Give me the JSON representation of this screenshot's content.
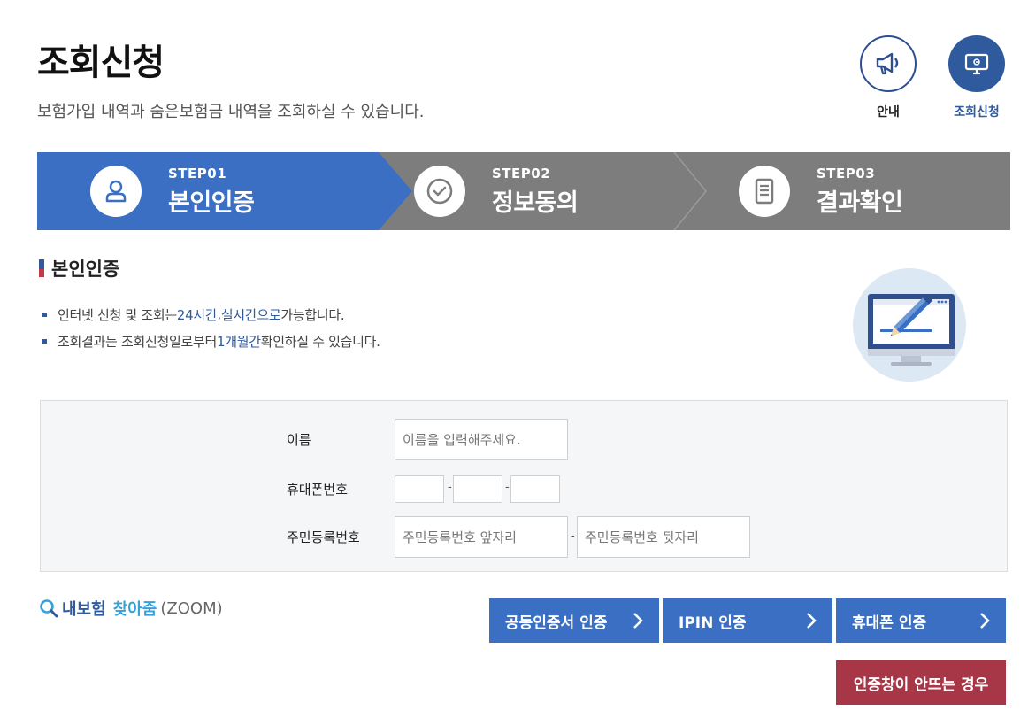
{
  "header": {
    "title": "조회신청",
    "subtitle": "보험가입 내역과 숨은보험금 내역을 조회하실 수 있습니다."
  },
  "top_icons": [
    {
      "label": "안내",
      "icon": "megaphone-icon"
    },
    {
      "label": "조회신청",
      "icon": "monitor-icon",
      "active": true
    }
  ],
  "steps": [
    {
      "num": "STEP01",
      "name": "본인인증",
      "icon": "user-icon",
      "active": true
    },
    {
      "num": "STEP02",
      "name": "정보동의",
      "icon": "check-circle-icon"
    },
    {
      "num": "STEP03",
      "name": "결과확인",
      "icon": "document-icon"
    }
  ],
  "section": {
    "title": "본인인증",
    "notes": [
      {
        "before": "인터넷 신청 및 조회는 ",
        "hl1": "24시간",
        "mid": ", ",
        "hl2": "실시간으로",
        "after": " 가능합니다."
      },
      {
        "before": "조회결과는 조회신청일로부터 ",
        "hl1": "1개월간",
        "after": " 확인하실 수 있습니다."
      }
    ]
  },
  "form": {
    "name_label": "이름",
    "name_placeholder": "이름을 입력해주세요.",
    "phone_label": "휴대폰번호",
    "phone_separator": "-",
    "rrn_label": "주민등록번호",
    "rrn_front_placeholder": "주민등록번호 앞자리",
    "rrn_back_placeholder": "주민등록번호 뒷자리",
    "rrn_separator": "-"
  },
  "zoom_logo": {
    "part1": "내보험",
    "part2": "찾아줌",
    "part3": "(ZOOM)"
  },
  "auth_buttons": [
    {
      "label": "공동인증서 인증"
    },
    {
      "label": "IPIN 인증"
    },
    {
      "label": "휴대폰 인증"
    }
  ],
  "help_button": {
    "label": "인증창이 안뜨는 경우"
  },
  "colors": {
    "primary": "#3a6fc4",
    "navy": "#2f5a9e",
    "step_inactive": "#7d7d7d",
    "help_red": "#a73747",
    "zoom_cyan": "#3aa0d8"
  }
}
